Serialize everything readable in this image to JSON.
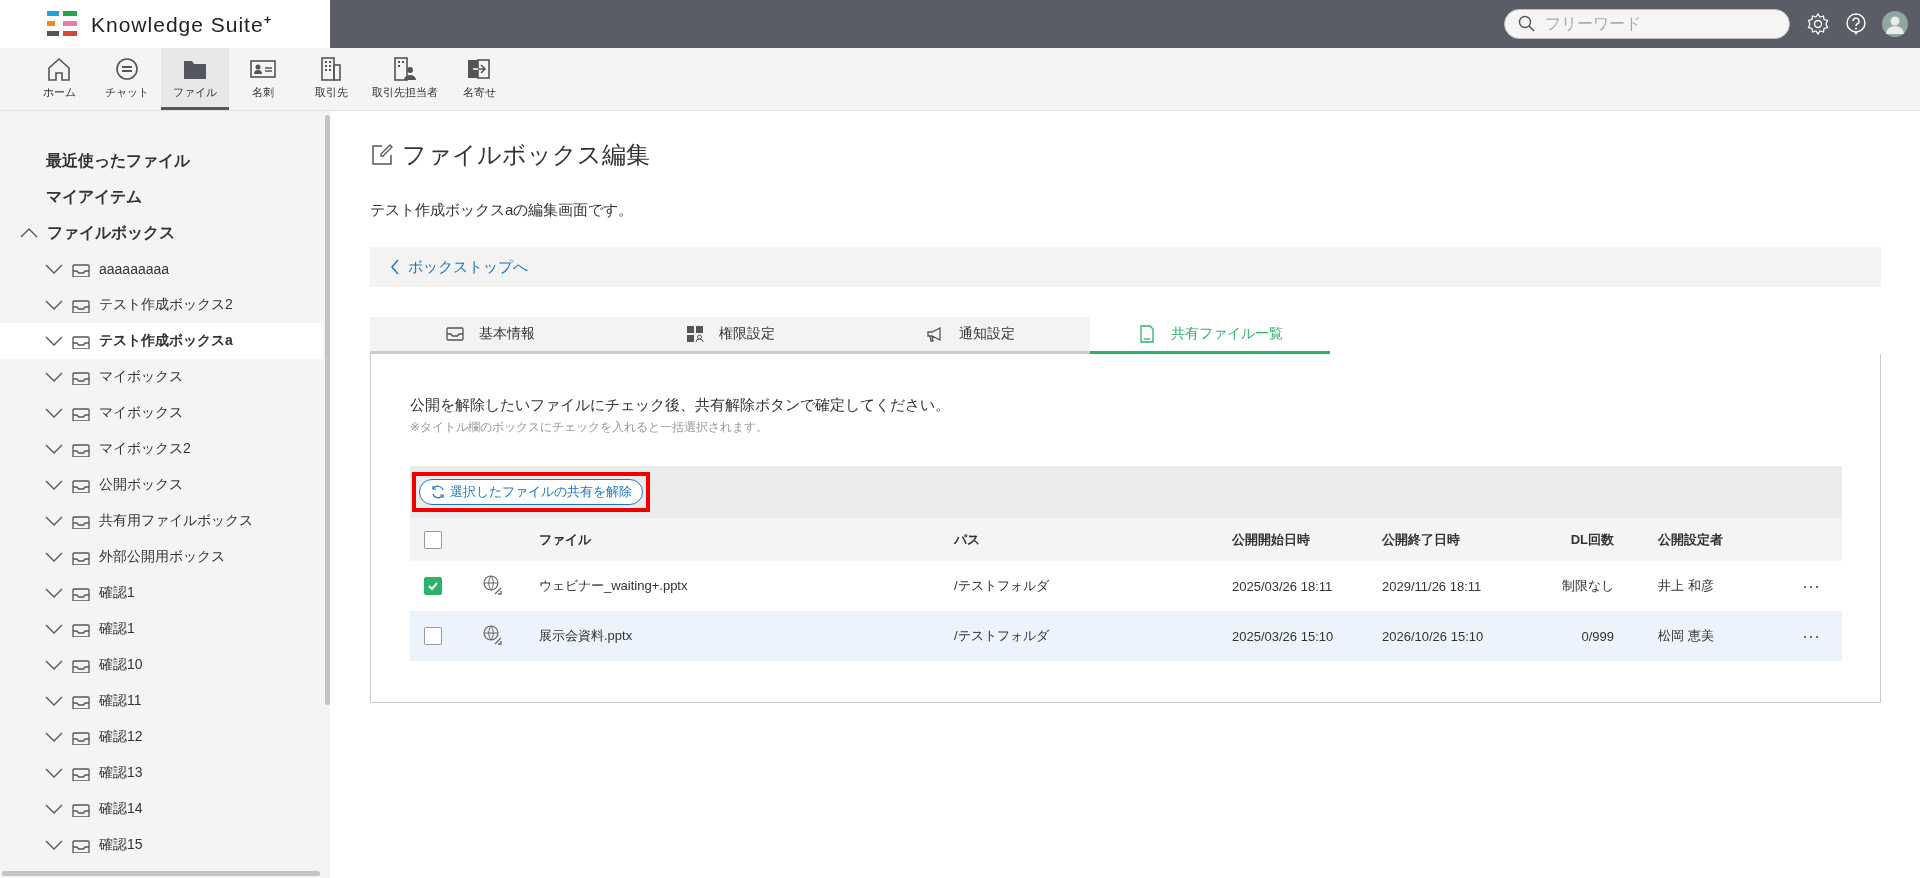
{
  "header": {
    "logo": "Knowledge Suite",
    "logo_mark": "+",
    "search": {
      "placeholder": "フリーワード"
    }
  },
  "nav": [
    {
      "label": "ホーム",
      "selected": false
    },
    {
      "label": "チャット",
      "selected": false
    },
    {
      "label": "ファイル",
      "selected": true
    },
    {
      "label": "名刺",
      "selected": false
    },
    {
      "label": "取引先",
      "selected": false
    },
    {
      "label": "取引先担当者",
      "selected": false
    },
    {
      "label": "名寄せ",
      "selected": false
    }
  ],
  "sidebar": {
    "items": [
      {
        "label": "最近使ったファイル"
      },
      {
        "label": "マイアイテム"
      },
      {
        "label": "ファイルボックス",
        "expanded": true,
        "children": [
          {
            "label": "aaaaaaaaa",
            "selected": false,
            "expanded": false
          },
          {
            "label": "テスト作成ボックス2",
            "selected": false,
            "expanded": false
          },
          {
            "label": "テスト作成ボックスa",
            "selected": true,
            "expanded": false
          },
          {
            "label": "マイボックス",
            "selected": false,
            "expanded": false
          },
          {
            "label": "マイボックス",
            "selected": false,
            "expanded": false
          },
          {
            "label": "マイボックス2",
            "selected": false,
            "expanded": false
          },
          {
            "label": "公開ボックス",
            "selected": false,
            "expanded": false
          },
          {
            "label": "共有用ファイルボックス",
            "selected": false,
            "expanded": false
          },
          {
            "label": "外部公開用ボックス",
            "selected": false,
            "expanded": false
          },
          {
            "label": "確認1",
            "selected": false,
            "expanded": false
          },
          {
            "label": "確認1",
            "selected": false,
            "expanded": false
          },
          {
            "label": "確認10",
            "selected": false,
            "expanded": false
          },
          {
            "label": "確認11",
            "selected": false,
            "expanded": false
          },
          {
            "label": "確認12",
            "selected": false,
            "expanded": false
          },
          {
            "label": "確認13",
            "selected": false,
            "expanded": false
          },
          {
            "label": "確認14",
            "selected": false,
            "expanded": false
          },
          {
            "label": "確認15",
            "selected": false,
            "expanded": false
          }
        ]
      }
    ]
  },
  "page": {
    "title": "ファイルボックス編集",
    "description": "テスト作成ボックスaの編集画面です。",
    "back_link": "ボックストップへ"
  },
  "tabs": [
    {
      "label": "基本情報",
      "selected": false
    },
    {
      "label": "権限設定",
      "selected": false
    },
    {
      "label": "通知設定",
      "selected": false
    },
    {
      "label": "共有ファイル一覧",
      "selected": true
    }
  ],
  "panel": {
    "instruction": "公開を解除したいファイルにチェック後、共有解除ボタンで確定してください。",
    "note": "※タイトル欄のボックスにチェックを入れると一括選択されます。",
    "unshare_button": {
      "label": "選択したファイルの共有を解除",
      "annotated": true
    },
    "table": {
      "select_all": {
        "checked": false
      },
      "columns": [
        "ファイル",
        "パス",
        "公開開始日時",
        "公開終了日時",
        "DL回数",
        "公開設定者"
      ],
      "rows": [
        {
          "checked": true,
          "highlighted": false,
          "cells": [
            "ウェビナー_waiting+.pptx",
            "/テストフォルダ",
            "2025/03/26 18:11",
            "2029/11/26 18:11",
            "制限なし",
            "井上 和彦"
          ],
          "more": "···"
        },
        {
          "checked": false,
          "highlighted": true,
          "cells": [
            "展示会資料.pptx",
            "/テストフォルダ",
            "2025/03/26 15:10",
            "2026/10/26 15:10",
            "0/999",
            "松岡 恵美"
          ],
          "more": "···"
        }
      ]
    }
  }
}
